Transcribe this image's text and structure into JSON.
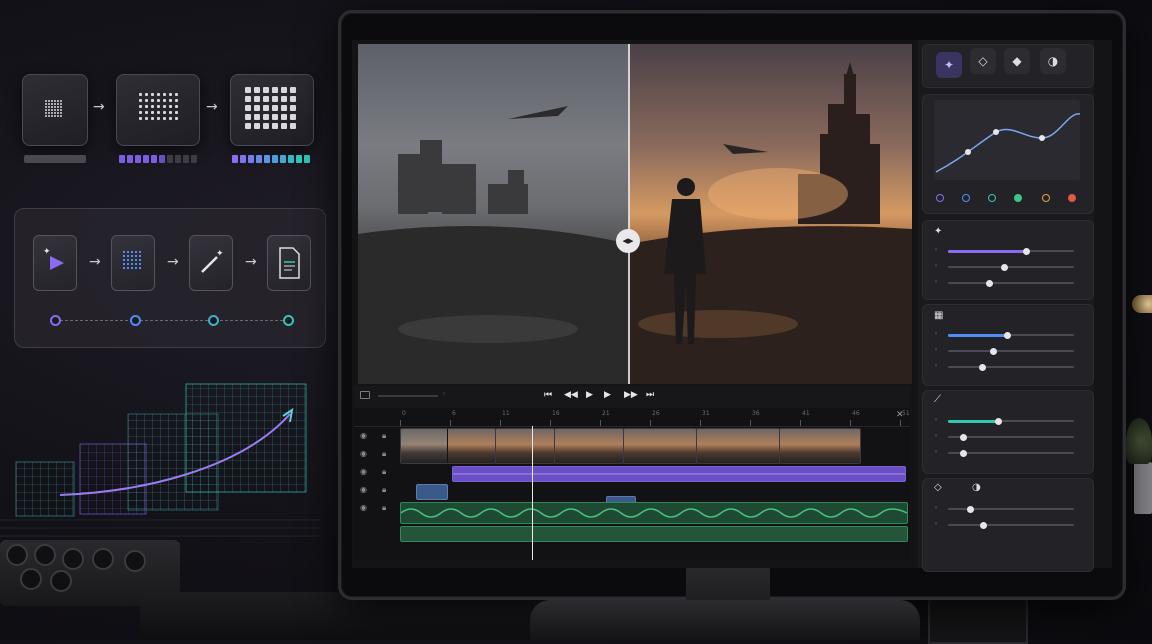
{
  "colors": {
    "accent_purple": "#8b6cf0",
    "accent_blue": "#4f8ef7",
    "accent_teal": "#33c7b5",
    "audio_green": "#2f8a57",
    "overlay_purple": "#6a4fc4"
  },
  "icons": {
    "pipeline": [
      "magic-play-icon",
      "pixel-grid-icon",
      "magic-wand-icon",
      "document-icon"
    ],
    "transport": [
      "skip-start-icon",
      "step-back-icon",
      "play-icon",
      "step-forward-icon",
      "skip-end-icon"
    ],
    "tools": [
      "sparkle-icon",
      "drop-outline-icon",
      "drop-fill-icon",
      "contrast-icon"
    ],
    "panel_sections": [
      "sparkle-icon",
      "grid-icon",
      "wand-icon",
      "drop-icon",
      "contrast-icon"
    ]
  },
  "viewer": {
    "compare_handle": "◂▸",
    "split_position": 0.49
  },
  "timeline": {
    "ruler_labels": [
      "0",
      "6",
      "11",
      "16",
      "21",
      "26",
      "31",
      "36",
      "41",
      "46",
      "51"
    ],
    "tracks": [
      "video",
      "overlay",
      "text",
      "audio-1",
      "audio-2"
    ],
    "playhead": 0.32
  },
  "panel": {
    "curve_nodes": [
      "purple",
      "blue",
      "teal",
      "green",
      "orange",
      "red"
    ],
    "sections": [
      {
        "name": "enhance",
        "sliders": [
          {
            "value": 0.62,
            "color": "#8b6cf0"
          },
          {
            "value": 0.45
          },
          {
            "value": 0.33
          }
        ]
      },
      {
        "name": "detail",
        "sliders": [
          {
            "value": 0.47,
            "color": "#4f8ef7"
          },
          {
            "value": 0.36
          },
          {
            "value": 0.27
          }
        ]
      },
      {
        "name": "restore",
        "sliders": [
          {
            "value": 0.4,
            "color": "#33c7b5"
          },
          {
            "value": 0.12
          },
          {
            "value": 0.12
          }
        ]
      },
      {
        "name": "color",
        "sliders": [
          {
            "value": 0.18
          },
          {
            "value": 0.28
          }
        ]
      }
    ]
  }
}
